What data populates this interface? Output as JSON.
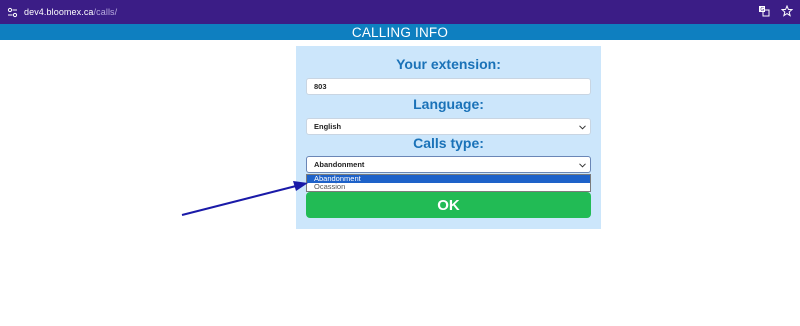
{
  "browser": {
    "url_host": "dev4.bloomex.ca",
    "url_path": "/calls/",
    "icons": [
      "site-settings-icon",
      "translate-icon",
      "bookmark-star-icon"
    ]
  },
  "header": {
    "title": "CALLING INFO"
  },
  "form": {
    "extension_label": "Your extension:",
    "extension_value": "803",
    "language_label": "Language:",
    "language_value": "English",
    "calls_type_label": "Calls type:",
    "calls_type_value": "Abandonment",
    "calls_type_options": [
      "Abandonment",
      "Ocassion"
    ],
    "ok_label": "OK"
  },
  "colors": {
    "browser_bar": "#3b1d86",
    "header_band": "#0e7fc0",
    "panel_bg": "#cce6fb",
    "label_text": "#1a72b8",
    "ok_button": "#22bb55",
    "option_highlight": "#1e62c9",
    "arrow": "#1a1aa8"
  },
  "annotation": {
    "type": "arrow",
    "color": "#1a1aa8",
    "points_to": "calls-type-dropdown"
  }
}
